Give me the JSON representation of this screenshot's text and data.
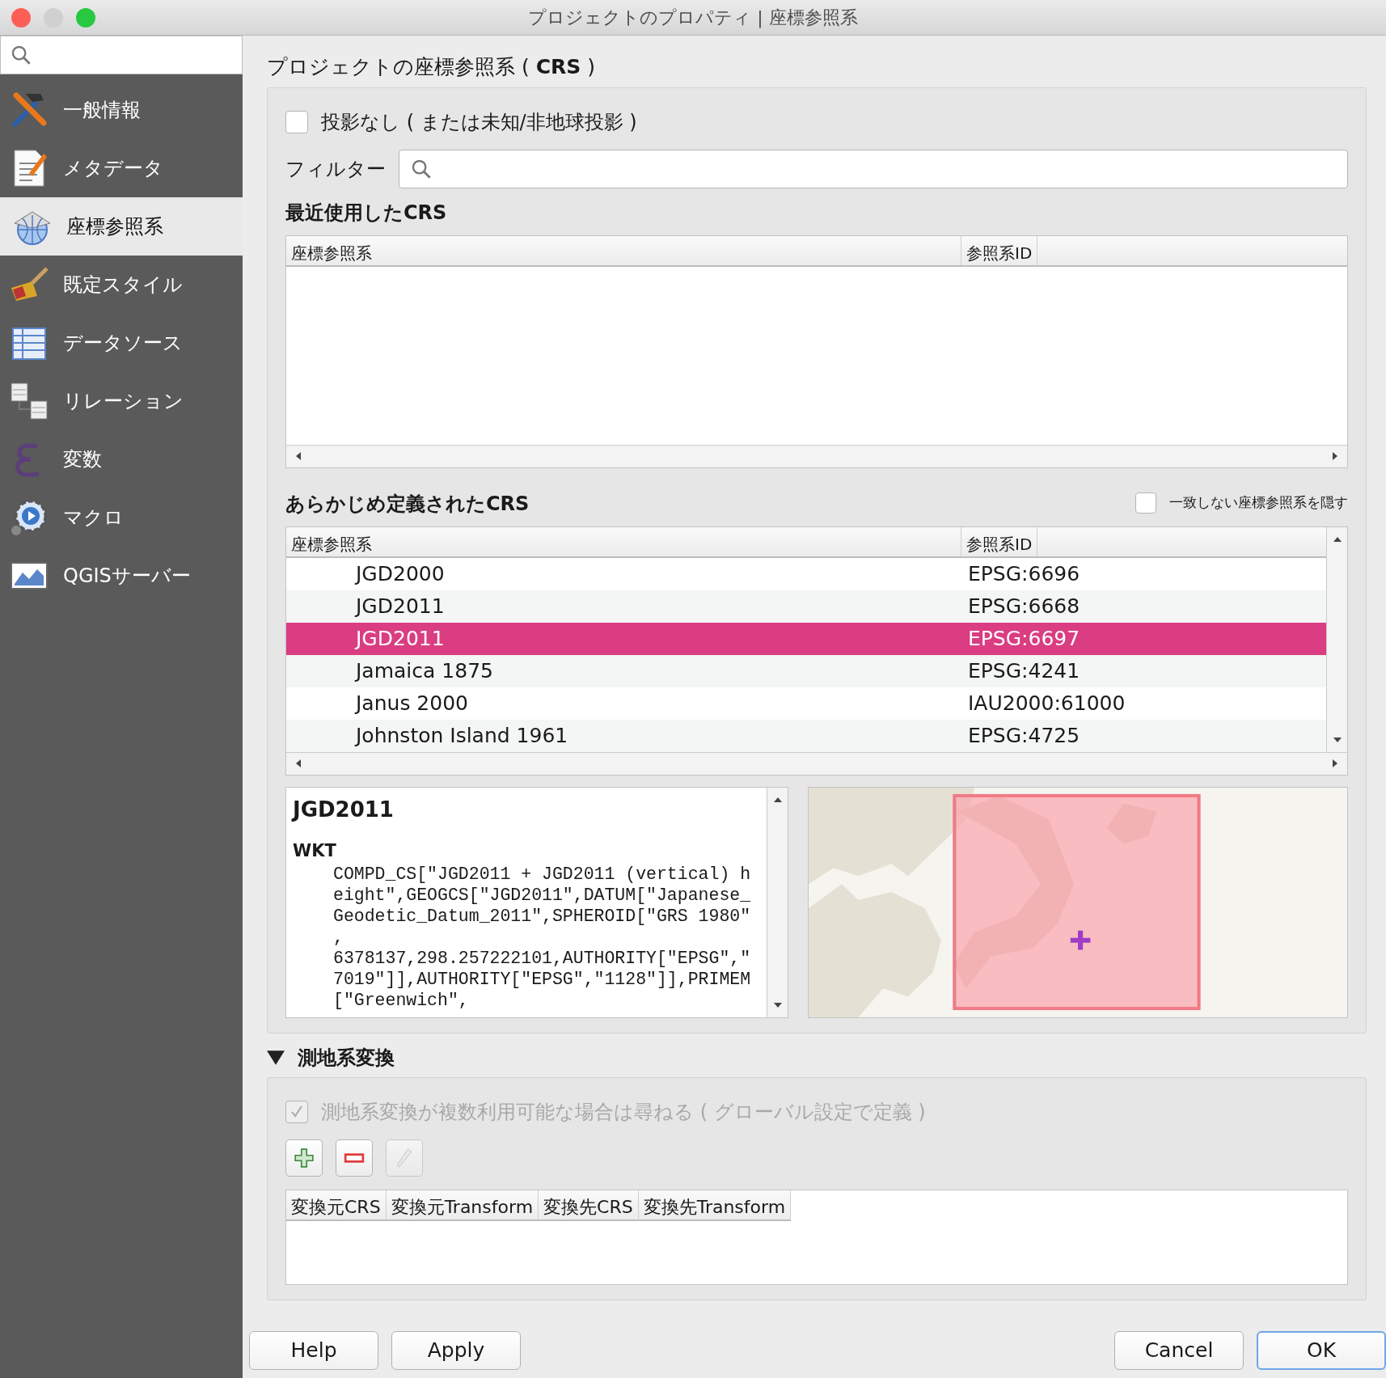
{
  "window": {
    "title": "プロジェクトのプロパティ | 座標参照系"
  },
  "sidebar": {
    "items": [
      {
        "label": "一般情報",
        "kind": "tools",
        "selected": false
      },
      {
        "label": "メタデータ",
        "kind": "document",
        "selected": false
      },
      {
        "label": "座標参照系",
        "kind": "globe",
        "selected": true
      },
      {
        "label": "既定スタイル",
        "kind": "brush",
        "selected": false
      },
      {
        "label": "データソース",
        "kind": "table",
        "selected": false
      },
      {
        "label": "リレーション",
        "kind": "relation",
        "selected": false
      },
      {
        "label": "変数",
        "kind": "epsilon",
        "selected": false
      },
      {
        "label": "マクロ",
        "kind": "macro",
        "selected": false
      },
      {
        "label": "QGISサーバー",
        "kind": "server",
        "selected": false
      }
    ]
  },
  "heading": "プロジェクトの座標参照系 ( **CRS** )",
  "no_projection": {
    "label": "投影なし ( または未知/非地球投影 )",
    "checked": false
  },
  "filter": {
    "label": "フィルター"
  },
  "recent": {
    "title": "最近使用した**CRS**",
    "columns": [
      "座標参照系",
      "参照系ID"
    ]
  },
  "predefined": {
    "title": "あらかじめ定義された**CRS**",
    "hide_checkbox": {
      "label": "一致しない座標参照系を隠す",
      "checked": false
    },
    "columns": [
      "座標参照系",
      "参照系ID"
    ],
    "rows": [
      {
        "name": "JGD2000",
        "id": "EPSG:6696",
        "selected": false
      },
      {
        "name": "JGD2011",
        "id": "EPSG:6668",
        "selected": false
      },
      {
        "name": "JGD2011",
        "id": "EPSG:6697",
        "selected": true
      },
      {
        "name": "Jamaica 1875",
        "id": "EPSG:4241",
        "selected": false
      },
      {
        "name": "Janus 2000",
        "id": "IAU2000:61000",
        "selected": false
      },
      {
        "name": "Johnston Island 1961",
        "id": "EPSG:4725",
        "selected": false
      }
    ]
  },
  "details": {
    "title": "JGD2011",
    "wkt_label": "WKT",
    "wkt_lines": [
      "COMPD_CS[\"JGD2011 + JGD2011 (vertical) h",
      "eight\",GEOGCS[\"JGD2011\",DATUM[\"Japanese_",
      "Geodetic_Datum_2011\",SPHEROID[\"GRS 1980\"",
      ",",
      "6378137,298.257222101,AUTHORITY[\"EPSG\",\"",
      "7019\"]],AUTHORITY[\"EPSG\",\"1128\"]],PRIMEM",
      "[\"Greenwich\","
    ]
  },
  "transform": {
    "title": "測地系変換",
    "expanded": true,
    "ask_checkbox": {
      "label": "測地系変換が複数利用可能な場合は尋ねる ( グローバル設定で定義 )",
      "checked": true,
      "disabled": true
    },
    "tools": [
      {
        "kind": "add",
        "disabled": false
      },
      {
        "kind": "remove",
        "disabled": false
      },
      {
        "kind": "edit",
        "disabled": true
      }
    ],
    "columns": [
      "変換元CRS",
      "変換元Transform",
      "変換先CRS",
      "変換先Transform"
    ]
  },
  "left_buttons": [
    {
      "label": "Help",
      "default": false
    },
    {
      "label": "Apply",
      "default": false
    }
  ],
  "right_buttons": [
    {
      "label": "Cancel",
      "default": false
    },
    {
      "label": "OK",
      "default": true
    }
  ]
}
